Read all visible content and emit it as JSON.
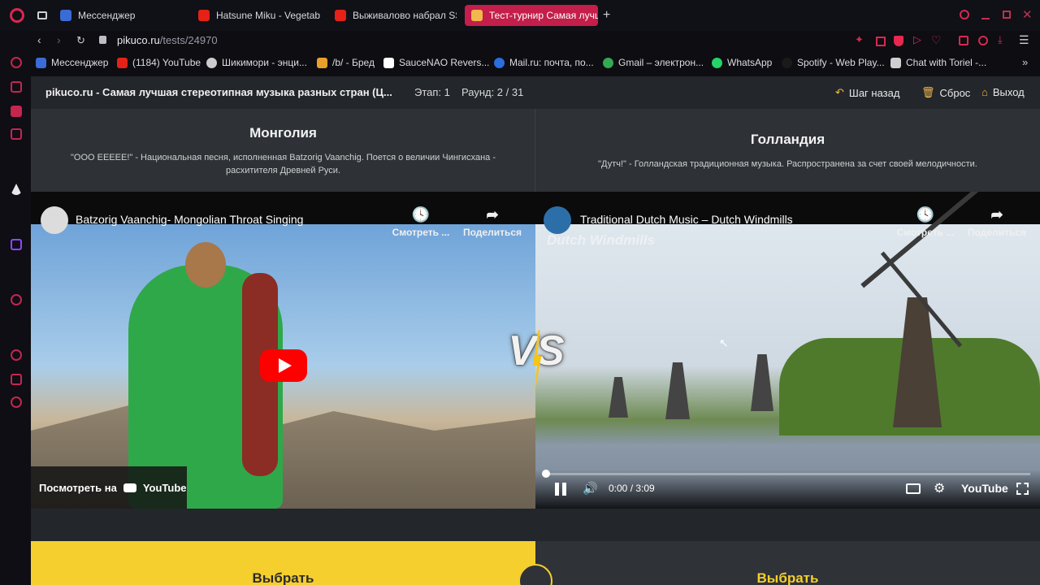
{
  "browser": {
    "tabs": [
      {
        "title": "Мессенджер",
        "fav": "#3b6bd6"
      },
      {
        "title": "Hatsune Miku - Vegetable",
        "fav": "#e62117"
      },
      {
        "title": "Выживалово набрал SSS",
        "fav": "#e62117"
      },
      {
        "title": "Тест-турнир Самая лучш",
        "fav": "#f2b84b"
      }
    ],
    "url_host": "pikuco.ru",
    "url_path": "/tests/24970",
    "bookmarks": [
      {
        "label": "Мессенджер",
        "color": "#3b6bd6"
      },
      {
        "label": "(1184) YouTube",
        "color": "#e62117"
      },
      {
        "label": "Шикимори - энци...",
        "color": "#cccccc"
      },
      {
        "label": "/b/ - Бред",
        "color": "#e8a02a"
      },
      {
        "label": "SauceNAO Revers...",
        "color": "#ffffff"
      },
      {
        "label": "Mail.ru: почта, по...",
        "color": "#2a6ee0"
      },
      {
        "label": "Gmail – электрон...",
        "color": "#34a853"
      },
      {
        "label": "WhatsApp",
        "color": "#25d366"
      },
      {
        "label": "Spotify - Web Play...",
        "color": "#1db954"
      },
      {
        "label": "Chat with Toriel -...",
        "color": "#cfcfcf"
      }
    ]
  },
  "page": {
    "site_title": "pikuco.ru - Самая лучшая стереотипная музыка разных стран (Ц...",
    "stage": "Этап: 1",
    "round": "Раунд: 2 / 31",
    "back_label": "Шаг назад",
    "reset_label": "Сброс",
    "exit_label": "Выход",
    "left": {
      "country": "Монголия",
      "desc": "\"ООО ЕЕЕЕЕ!\" - Национальная песня, исполненная Batzorig Vaanchig. Поется о величии Чингисхана - расхитителя Древней Руси.",
      "video_title": "Batzorig Vaanchig- Mongolian Throat Singing",
      "watch_later": "Смотреть ...",
      "share": "Поделиться",
      "watch_on": "Посмотреть на",
      "youtube": "YouTube",
      "choose": "Выбрать"
    },
    "right": {
      "country": "Голландия",
      "desc": "\"Дутч!\" - Голландская традиционная музыка. Распространена за счет своей мелодичности.",
      "video_title": "Traditional Dutch Music – Dutch Windmills",
      "watermark": "Dutch Windmills",
      "watch_later": "Смотреть ...",
      "share": "Поделиться",
      "time": "0:00 / 3:09",
      "youtube": "YouTube",
      "choose": "Выбрать"
    },
    "vs_label": "VS"
  }
}
